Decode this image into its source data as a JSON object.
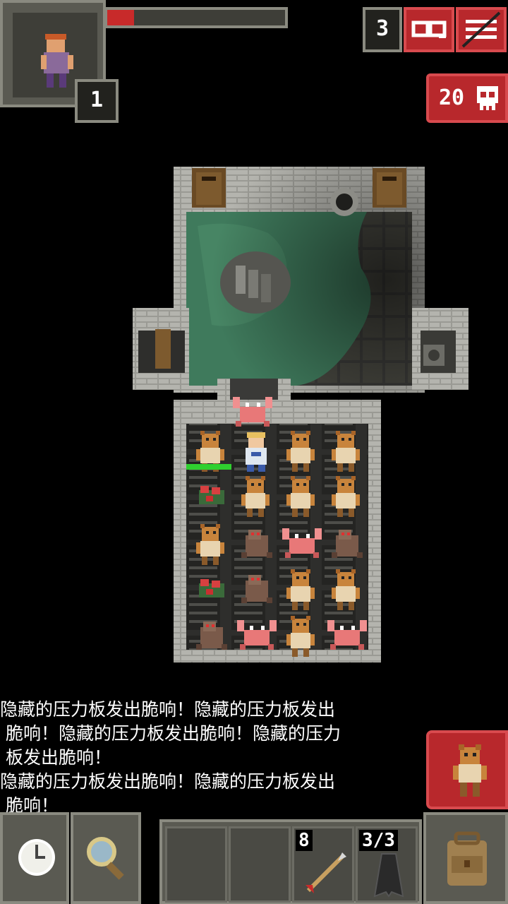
{
  "hud": {
    "hero_level": "1",
    "depth": "3",
    "danger_count": "20",
    "hp_fraction": 0.15
  },
  "icons": {
    "journal": "journal-icon",
    "menu": "menu-icon",
    "danger": "skull-icon",
    "wait": "clock-icon",
    "search": "magnifier-icon",
    "backpack": "backpack-icon",
    "attack_target": "gnoll-icon"
  },
  "log": {
    "lines": [
      "隐藏的压力板发出脆响！隐藏的压力板发出",
      " 脆响！隐藏的压力板发出脆响！隐藏的压力",
      " 板发出脆响！",
      "隐藏的压力板发出脆响！隐藏的压力板发出",
      " 脆响！"
    ]
  },
  "quickslots": {
    "darts_count": "8",
    "cloak_charges": "3/3"
  },
  "colors": {
    "accent_red": "#b8282c",
    "water": "#3f7a5c",
    "stone": "#8c8c86"
  }
}
